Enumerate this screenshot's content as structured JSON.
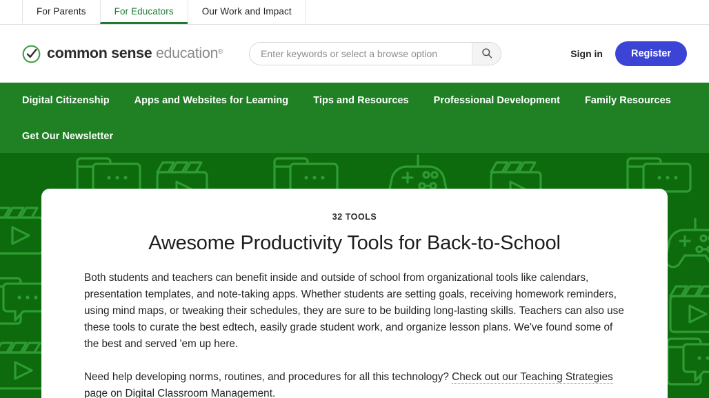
{
  "topbar": {
    "tabs": [
      {
        "label": "For Parents",
        "active": false
      },
      {
        "label": "For Educators",
        "active": true
      },
      {
        "label": "Our Work and Impact",
        "active": false
      }
    ]
  },
  "masthead": {
    "logo": {
      "icon": "check-circle-icon",
      "bold_text": "common sense",
      "light_text": "education",
      "registered_mark": "®"
    },
    "search": {
      "placeholder": "Enter keywords or select a browse option",
      "value": "",
      "button_icon": "search-icon"
    },
    "sign_in_label": "Sign in",
    "register_label": "Register"
  },
  "mainnav": {
    "items": [
      "Digital Citizenship",
      "Apps and Websites for Learning",
      "Tips and Resources",
      "Professional Development",
      "Family Resources"
    ],
    "second_row": [
      "Get Our Newsletter"
    ]
  },
  "hero": {
    "eyebrow": "32 TOOLS",
    "title": "Awesome Productivity Tools for Back-to-School",
    "paragraph1": "Both students and teachers can benefit inside and outside of school from organizational tools like calendars, presentation templates, and note-taking apps. Whether students are setting goals, receiving homework reminders, using mind maps, or tweaking their schedules, they are sure to be building long-lasting skills. Teachers can also use these tools to curate the best edtech, easily grade student work, and organize lesson plans. We've found some of the best and served 'em up here.",
    "paragraph2_lead": "Need help developing norms, routines, and procedures for all this technology? ",
    "paragraph2_link": "Check out our Teaching Strategies page on Digital Classroom Management",
    "paragraph2_tail": ".",
    "background_icons": [
      "tablet-chat-icon",
      "film-clapper-icon",
      "chat-bubble-icon",
      "game-controller-icon"
    ]
  },
  "colors": {
    "nav_green": "#1f8024",
    "hero_green": "#0d6b0d",
    "pattern_green": "#2f9c33",
    "accent_blue": "#3b44d4",
    "active_tab_green": "#1f7a33"
  }
}
